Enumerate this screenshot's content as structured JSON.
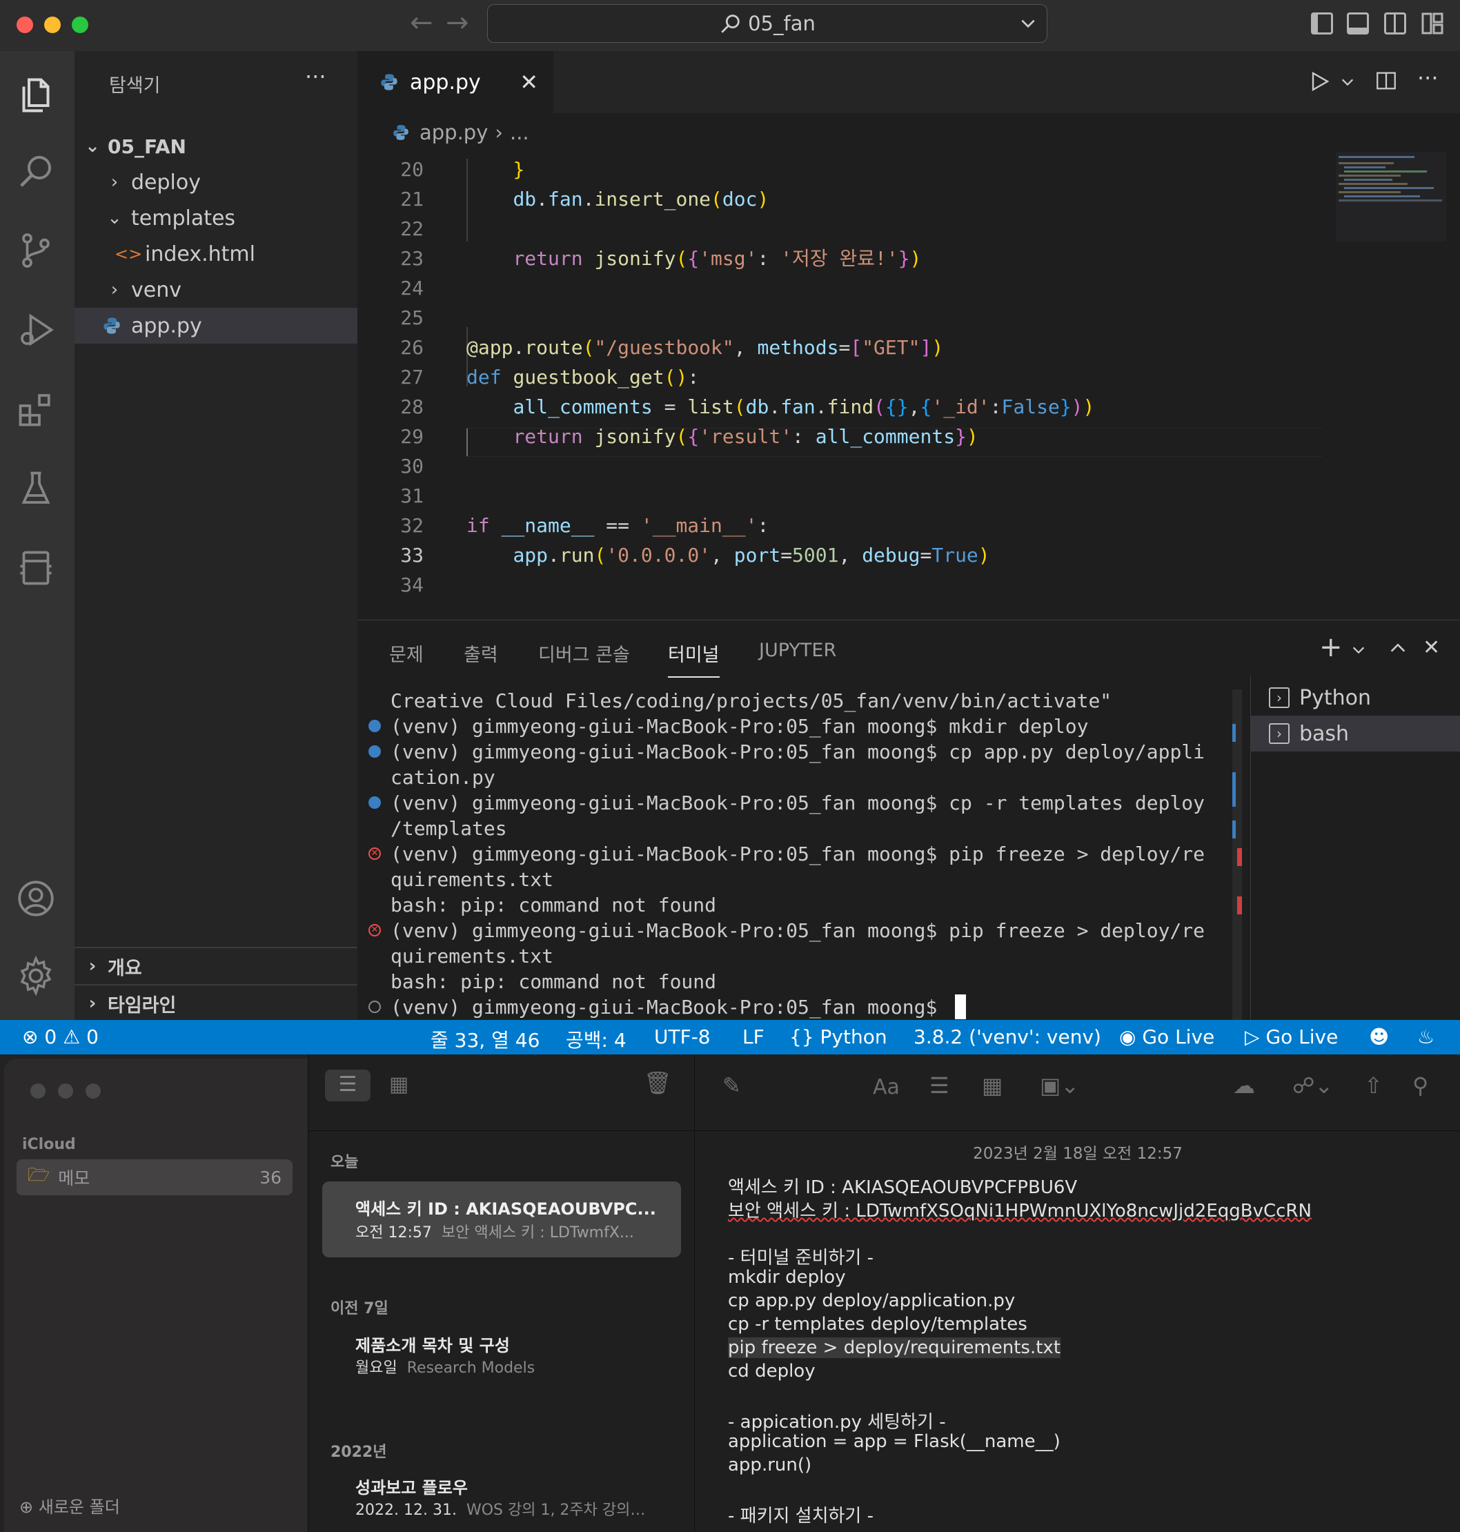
{
  "titlebar": {
    "search_text": "05_fan"
  },
  "sidebar": {
    "title": "탐색기",
    "more": "···",
    "folder": "05_FAN",
    "items": [
      {
        "label": "deploy",
        "kind": "folder-collapsed"
      },
      {
        "label": "templates",
        "kind": "folder-expanded"
      },
      {
        "label": "index.html",
        "kind": "html-file"
      },
      {
        "label": "venv",
        "kind": "folder-collapsed"
      },
      {
        "label": "app.py",
        "kind": "python-file"
      }
    ],
    "outline": "개요",
    "timeline": "타임라인"
  },
  "editor": {
    "tab_label": "app.py",
    "breadcrumb_file": "app.py",
    "breadcrumb_more": "...",
    "lines": [
      {
        "n": "20",
        "text": "    }"
      },
      {
        "n": "21",
        "text": "    db.fan.insert_one(doc)"
      },
      {
        "n": "22",
        "text": ""
      },
      {
        "n": "23",
        "text": "    return jsonify({'msg': '저장 완료!'})"
      },
      {
        "n": "24",
        "text": ""
      },
      {
        "n": "25",
        "text": ""
      },
      {
        "n": "26",
        "text": "@app.route(\"/guestbook\", methods=[\"GET\"])"
      },
      {
        "n": "27",
        "text": "def guestbook_get():"
      },
      {
        "n": "28",
        "text": "    all_comments = list(db.fan.find({},{'_id':False}))"
      },
      {
        "n": "29",
        "text": "    return jsonify({'result': all_comments})"
      },
      {
        "n": "30",
        "text": ""
      },
      {
        "n": "31",
        "text": ""
      },
      {
        "n": "32",
        "text": "if __name__ == '__main__':"
      },
      {
        "n": "33",
        "text": "    app.run('0.0.0.0', port=5001, debug=True)"
      },
      {
        "n": "34",
        "text": ""
      }
    ]
  },
  "panel": {
    "tabs": [
      "문제",
      "출력",
      "디버그 콘솔",
      "터미널",
      "JUPYTER"
    ],
    "active_tab": "터미널",
    "terminal_lines": [
      {
        "text": "Creative Cloud Files/coding/projects/05_fan/venv/bin/activate\"",
        "marker": "none"
      },
      {
        "text": "(venv) gimmyeong-giui-MacBook-Pro:05_fan moong$ mkdir deploy",
        "marker": "ok"
      },
      {
        "text": "(venv) gimmyeong-giui-MacBook-Pro:05_fan moong$ cp app.py deploy/appli",
        "marker": "ok"
      },
      {
        "text": "cation.py",
        "marker": "none"
      },
      {
        "text": "(venv) gimmyeong-giui-MacBook-Pro:05_fan moong$ cp -r templates deploy",
        "marker": "ok"
      },
      {
        "text": "/templates",
        "marker": "none"
      },
      {
        "text": "(venv) gimmyeong-giui-MacBook-Pro:05_fan moong$ pip freeze > deploy/re",
        "marker": "error"
      },
      {
        "text": "quirements.txt",
        "marker": "none"
      },
      {
        "text": "bash: pip: command not found",
        "marker": "none"
      },
      {
        "text": "(venv) gimmyeong-giui-MacBook-Pro:05_fan moong$ pip freeze > deploy/re",
        "marker": "error"
      },
      {
        "text": "quirements.txt",
        "marker": "none"
      },
      {
        "text": "bash: pip: command not found",
        "marker": "none"
      },
      {
        "text": "(venv) gimmyeong-giui-MacBook-Pro:05_fan moong$ ",
        "marker": "pending"
      }
    ],
    "terminals": [
      "Python",
      "bash"
    ]
  },
  "statusbar": {
    "errors": "0",
    "warnings": "0",
    "position": "줄 33, 열 46",
    "spaces": "공백: 4",
    "encoding": "UTF-8",
    "eol": "LF",
    "language": "Python",
    "interpreter": "3.8.2 ('venv': venv)",
    "golive1": "Go Live",
    "golive2": "Go Live"
  },
  "notes": {
    "icloud": "iCloud",
    "folder": "메모",
    "folder_count": "36",
    "new_folder": "새로운 폴더",
    "sections": [
      {
        "header": "오늘",
        "items": [
          {
            "title": "액세스 키 ID : AKIASQEAOUBVPC...",
            "time": "오전 12:57",
            "preview": "보안 액세스 키 : LDTwmfX..."
          }
        ]
      },
      {
        "header": "이전 7일",
        "items": [
          {
            "title": "제품소개 목차 및 구성",
            "time": "월요일",
            "preview": "Research Models"
          }
        ]
      },
      {
        "header": "2022년",
        "items": [
          {
            "title": "성과보고 플로우",
            "time": "2022. 12. 31.",
            "preview": "WOS 강의 1, 2주차 강의…"
          }
        ]
      }
    ],
    "date": "2023년 2월 18일 오전 12:57",
    "body_lines": [
      "액세스 키 ID : AKIASQEAOUBVPCFPBU6V",
      "보안 액세스 키 : LDTwmfXSOqNi1HPWmnUXlYo8ncwJjd2EqgBvCcRN",
      "",
      "- 터미널 준비하기 -",
      "mkdir deploy",
      "cp app.py deploy/application.py",
      "cp -r templates deploy/templates",
      "pip freeze > deploy/requirements.txt",
      "cd deploy",
      "",
      "- appication.py 세팅하기 -",
      "application = app = Flask(__name__)",
      "app.run()",
      "",
      "- 패키지 설치하기 -"
    ]
  }
}
